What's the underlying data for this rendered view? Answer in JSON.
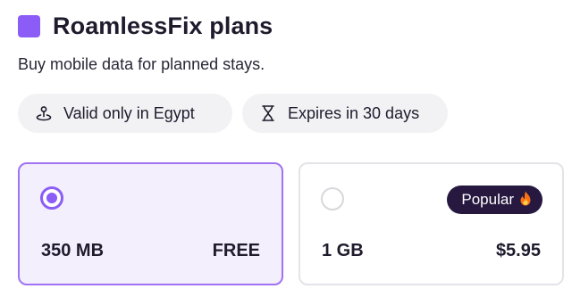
{
  "header": {
    "title": "RoamlessFix plans",
    "subtitle": "Buy mobile data for planned stays.",
    "brand_color": "#8b5cf6"
  },
  "info_pills": [
    {
      "icon": "map-pin-icon",
      "label": "Valid only in Egypt"
    },
    {
      "icon": "hourglass-icon",
      "label": "Expires in 30 days"
    }
  ],
  "plans": [
    {
      "size": "350 MB",
      "price": "FREE",
      "selected": true
    },
    {
      "size": "1 GB",
      "price": "$5.95",
      "selected": false,
      "badge": "Popular",
      "badge_icon": "fire-icon"
    }
  ],
  "colors": {
    "accent": "#8b5cf6",
    "selected_bg": "#f3effd",
    "badge_bg": "#26183f"
  }
}
